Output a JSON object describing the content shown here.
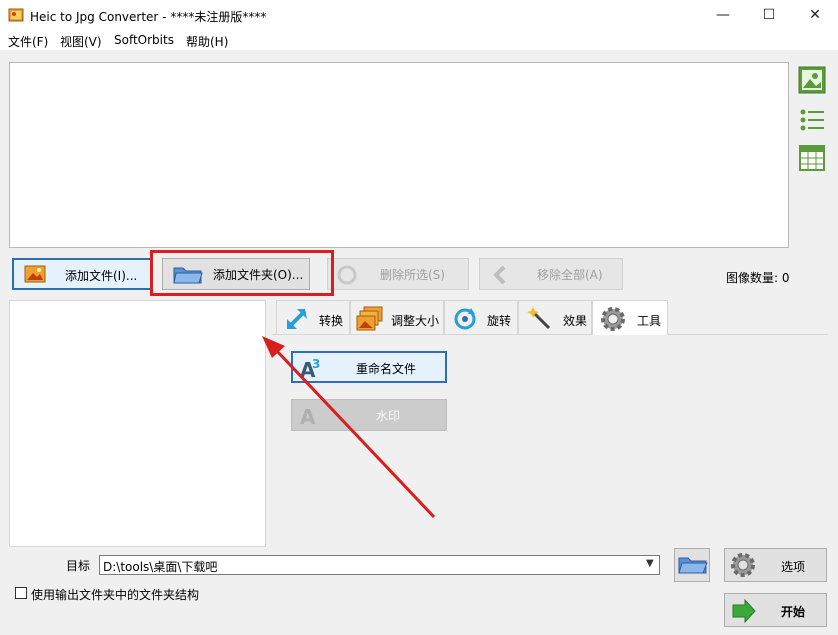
{
  "window": {
    "title": "Heic to Jpg Converter - ****未注册版****",
    "controls": {
      "minimize": "—",
      "maximize": "☐",
      "close": "✕"
    }
  },
  "menu": [
    "文件(F)",
    "视图(V)",
    "SoftOrbits",
    "帮助(H)"
  ],
  "toolbar": {
    "add_files": "添加文件(I)...",
    "add_folder": "添加文件夹(O)...",
    "delete_selected": "删除所选(S)",
    "remove_all": "移除全部(A)",
    "image_count": "图像数量: 0"
  },
  "side_view_icons": [
    "image-view-icon",
    "list-view-icon",
    "grid-view-icon"
  ],
  "tabs": [
    {
      "label": "转换",
      "icon": "convert-arrow-icon"
    },
    {
      "label": "调整大小",
      "icon": "resize-images-icon"
    },
    {
      "label": "旋转",
      "icon": "rotate-icon"
    },
    {
      "label": "效果",
      "icon": "magic-wand-icon"
    },
    {
      "label": "工具",
      "icon": "gear-icon",
      "active": true
    }
  ],
  "tools": {
    "rename_files": "重命名文件",
    "watermark": "水印"
  },
  "bottom": {
    "target_label": "目标",
    "target_path": "D:\\tools\\桌面\\下载吧",
    "options_button": "选项",
    "start_button": "开始",
    "preserve_structure_label": "使用输出文件夹中的文件夹结构"
  },
  "colors": {
    "annotation_red": "#d91e1e",
    "primary_border": "#2f6db5",
    "start_green": "#3aa83a"
  }
}
